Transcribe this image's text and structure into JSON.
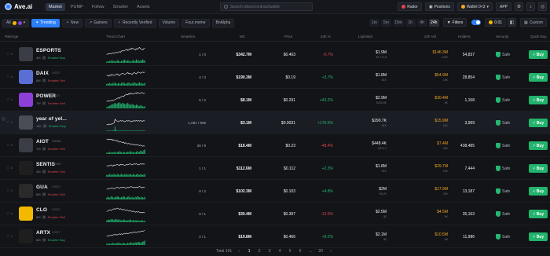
{
  "app": {
    "name": "Ave.ai"
  },
  "nav": [
    "Market",
    "PUMP",
    "Follow",
    "Smarter",
    "Assets"
  ],
  "search": {
    "placeholder": "Search token/contract/wallet"
  },
  "topbar": {
    "rador": "Rador",
    "positions": "Positions",
    "wallet": "Wallet 0×3",
    "app": "APP"
  },
  "filters": {
    "chain": "All",
    "chips": [
      "Trending",
      "New",
      "Gainers",
      "Recently Verified",
      "Volume",
      "Four.meme",
      "BnAlpha"
    ],
    "times": [
      "1m",
      "5m",
      "15m",
      "1h",
      "4h",
      "24h"
    ],
    "filters_label": "Filters",
    "sol": "0.01",
    "custom": "Custom"
  },
  "header": {
    "pair_age": "Pair/Age",
    "trend": "Trend Chart",
    "smarters": "Smarters",
    "mc": "MC",
    "price": "Price",
    "chg": "24h %",
    "liq": "Liq/Initial",
    "vol": "24h Vol",
    "holders": "Holders",
    "security": "Security",
    "quick_buy": "Quick Buy"
  },
  "rows": [
    {
      "name": "ESPORTS",
      "tk": "/WBNB",
      "age": "4M",
      "tag": "Smarter Buy",
      "tagtype": "b",
      "smart": "1 / 0",
      "mc": "$342.7M",
      "price": "$0.403",
      "chg": "-0.7%",
      "dir": "dn",
      "liq": "$1.9M",
      "liq2": "$1,771.8",
      "vol": "$146.3M",
      "vol2": "140K",
      "hold": "54,837",
      "color": "#3a3d45",
      "spark": [
        6,
        7,
        7,
        8,
        7,
        8,
        9,
        8,
        9,
        10,
        9,
        10,
        11,
        10,
        12,
        13,
        12,
        13,
        14,
        15,
        13,
        14,
        16,
        15,
        17,
        16,
        15,
        14,
        16,
        15,
        17,
        18,
        16,
        15,
        14,
        16,
        17
      ],
      "bars": [
        2,
        3,
        2,
        4,
        3,
        5,
        3,
        4,
        2,
        3,
        5,
        4,
        3,
        2,
        4,
        3,
        5,
        6,
        4,
        3,
        5,
        4,
        3,
        2,
        4,
        5,
        3,
        4,
        6,
        5,
        4,
        3,
        5,
        4,
        6,
        5,
        4
      ]
    },
    {
      "name": "DAIX",
      "tk": "/USDT",
      "age": "8M",
      "tag": "Smarter Sell",
      "tagtype": "s",
      "smart": "4 / 3",
      "mc": "$190.3M",
      "price": "$0.19",
      "chg": "+3.7%",
      "dir": "up",
      "liq": "$1.8M",
      "liq2": "$1K",
      "vol": "$54.9M",
      "vol2": "16K",
      "hold": "28,854",
      "color": "#5a6fd6",
      "spark": [
        10,
        9,
        8,
        10,
        9,
        11,
        10,
        9,
        10,
        11,
        12,
        10,
        9,
        11,
        12,
        13,
        12,
        11,
        12,
        13,
        14,
        12,
        13,
        12,
        11,
        13,
        14,
        13,
        12,
        14,
        15,
        14,
        13,
        14,
        15,
        14,
        15
      ],
      "bars": [
        3,
        4,
        3,
        5,
        4,
        3,
        5,
        4,
        6,
        4,
        3,
        5,
        4,
        3,
        5,
        6,
        4,
        5,
        3,
        4,
        5,
        6,
        4,
        3,
        5,
        4,
        6,
        5,
        4,
        3,
        5,
        6,
        4,
        5,
        3,
        4,
        5
      ]
    },
    {
      "name": "POWER",
      "tk": "/USDT",
      "age": "7M",
      "tag": "Smarter Sell",
      "tagtype": "s",
      "smart": "5 / 2",
      "mc": "$8.1M",
      "price": "$0.291",
      "chg": "+43.2%",
      "dir": "up",
      "liq": "$2.9M",
      "liq2": "$400.8K",
      "vol": "$30.4M",
      "vol2": "6K",
      "hold": "1,158",
      "color": "#8e3fd8",
      "spark": [
        4,
        4,
        5,
        4,
        5,
        6,
        5,
        6,
        7,
        8,
        9,
        10,
        9,
        11,
        12,
        13,
        12,
        14,
        15,
        16,
        15,
        17,
        16,
        18,
        17,
        16,
        17,
        18,
        17,
        19,
        18,
        17,
        18,
        19,
        18,
        17,
        18
      ],
      "bars": [
        2,
        3,
        4,
        5,
        6,
        8,
        7,
        9,
        10,
        8,
        9,
        10,
        11,
        9,
        8,
        10,
        9,
        8,
        7,
        9,
        10,
        8,
        7,
        6,
        8,
        7,
        6,
        5,
        7,
        6,
        5,
        4,
        6,
        5,
        4,
        3,
        4
      ]
    },
    {
      "name": "year of yel...",
      "tk": "",
      "age": "16h",
      "tag": "Smarter Buy",
      "tagtype": "b",
      "smart": "1,091 / 905",
      "mc": "$3.1M",
      "price": "$0.0031",
      "chg": "+176.5%",
      "dir": "up",
      "liq": "$290.7K",
      "liq2": "$1K",
      "vol": "$15.9M",
      "vol2": "61K",
      "hold": "3,999",
      "color": "#4a4d55",
      "spark": [
        3,
        3,
        4,
        3,
        4,
        4,
        5,
        6,
        12,
        10,
        9,
        8,
        9,
        10,
        9,
        10,
        9,
        8,
        9,
        10,
        9,
        10,
        9,
        8,
        9,
        9,
        10,
        9,
        10,
        9,
        10,
        9,
        10,
        9,
        9,
        10,
        9
      ],
      "bars": [
        1,
        1,
        1,
        1,
        1,
        1,
        1,
        2,
        8,
        2,
        1,
        1,
        1,
        1,
        1,
        1,
        1,
        1,
        1,
        1,
        1,
        1,
        1,
        1,
        1,
        1,
        1,
        1,
        1,
        1,
        1,
        1,
        1,
        1,
        1,
        1,
        1
      ]
    },
    {
      "name": "AIOT",
      "tk": "/WBNB",
      "age": "7M",
      "tag": "Smarter Sell",
      "tagtype": "s",
      "smart": "26 / 9",
      "mc": "$18.4M",
      "price": "$0.23",
      "chg": "-48.4%",
      "dir": "dn",
      "liq": "$448.4K",
      "liq2": "$211.2",
      "vol": "$7.4M",
      "vol2": "26K",
      "hold": "438,485",
      "color": "#3a3d45",
      "spark": [
        17,
        17,
        16,
        17,
        16,
        17,
        15,
        16,
        15,
        14,
        15,
        13,
        12,
        13,
        12,
        11,
        12,
        10,
        11,
        10,
        9,
        10,
        9,
        8,
        9,
        8,
        7,
        8,
        7,
        8,
        7,
        6,
        7,
        6,
        5,
        6,
        5
      ],
      "bars": [
        2,
        3,
        2,
        4,
        3,
        2,
        3,
        4,
        3,
        2,
        4,
        3,
        5,
        4,
        3,
        2,
        4,
        3,
        2,
        3,
        4,
        3,
        5,
        4,
        3,
        4,
        2,
        3,
        4,
        5,
        3,
        4,
        6,
        5,
        4,
        7,
        8
      ]
    },
    {
      "name": "SENTIS",
      "tk": "/WBNB",
      "age": "4M",
      "tag": "Smarter Sell",
      "tagtype": "s",
      "smart": "1 / 1",
      "mc": "$112.6M",
      "price": "$0.112",
      "chg": "+2.3%",
      "dir": "up",
      "liq": "$1.8M",
      "liq2": "$1K",
      "vol": "$29.7M",
      "vol2": "16K",
      "hold": "7,444",
      "color": "#1e1e1e",
      "spark": [
        10,
        11,
        10,
        11,
        12,
        11,
        10,
        12,
        11,
        12,
        13,
        12,
        11,
        13,
        12,
        13,
        12,
        11,
        12,
        13,
        12,
        13,
        14,
        13,
        12,
        13,
        14,
        13,
        14,
        13,
        12,
        13,
        14,
        13,
        14,
        13,
        14
      ],
      "bars": [
        3,
        4,
        3,
        5,
        4,
        3,
        4,
        5,
        4,
        3,
        5,
        4,
        3,
        4,
        5,
        4,
        3,
        5,
        4,
        5,
        3,
        4,
        5,
        4,
        3,
        5,
        4,
        3,
        4,
        5,
        4,
        3,
        5,
        4,
        3,
        4,
        5
      ]
    },
    {
      "name": "GUA",
      "tk": "/USDT",
      "age": "8M",
      "tag": "Smarter Sell",
      "tagtype": "s",
      "smart": "0 / 2",
      "mc": "$102.3M",
      "price": "$0.103",
      "chg": "+4.8%",
      "dir": "up",
      "liq": "$2M",
      "liq2": "$6.2K",
      "vol": "$17.9M",
      "vol2": "32K",
      "hold": "13,187",
      "color": "#2a2a2a",
      "spark": [
        9,
        10,
        11,
        10,
        11,
        12,
        11,
        10,
        11,
        12,
        13,
        12,
        11,
        12,
        13,
        12,
        13,
        12,
        11,
        12,
        13,
        12,
        13,
        14,
        13,
        12,
        13,
        12,
        13,
        12,
        13,
        14,
        13,
        12,
        13,
        12,
        13
      ],
      "bars": [
        3,
        5,
        4,
        3,
        5,
        6,
        4,
        3,
        5,
        4,
        6,
        5,
        4,
        3,
        5,
        4,
        6,
        5,
        3,
        4,
        5,
        6,
        4,
        3,
        5,
        4,
        3,
        5,
        4,
        6,
        5,
        4,
        3,
        5,
        4,
        3,
        5
      ]
    },
    {
      "name": "CLO",
      "tk": "/USDT",
      "age": "8M",
      "tag": "Smarter Sell",
      "tagtype": "s",
      "smart": "0 / 1",
      "mc": "$30.4M",
      "price": "$0.397",
      "chg": "-12.6%",
      "dir": "dn",
      "liq": "$2.5M",
      "liq2": "$0",
      "vol": "$4.5M",
      "vol2": "9K",
      "hold": "35,163",
      "color": "#f5b800",
      "spark": [
        10,
        11,
        12,
        13,
        12,
        13,
        14,
        15,
        14,
        15,
        16,
        15,
        14,
        15,
        14,
        13,
        14,
        13,
        12,
        13,
        12,
        11,
        12,
        11,
        10,
        11,
        10,
        9,
        10,
        9,
        10,
        9,
        8,
        9,
        8,
        9,
        8
      ],
      "bars": [
        3,
        4,
        5,
        4,
        5,
        6,
        5,
        4,
        5,
        6,
        5,
        4,
        5,
        4,
        3,
        4,
        5,
        4,
        3,
        4,
        3,
        4,
        5,
        4,
        3,
        4,
        3,
        4,
        3,
        4,
        3,
        2,
        3,
        4,
        3,
        2,
        3
      ]
    },
    {
      "name": "ARTX",
      "tk": "/USDT",
      "age": "8M",
      "tag": "Smarter Buy",
      "tagtype": "b",
      "smart": "2 / 1",
      "mc": "$19.8M",
      "price": "$0.466",
      "chg": "+9.2%",
      "dir": "up",
      "liq": "$2.1M",
      "liq2": "$0",
      "vol": "$10.5M",
      "vol2": "1M",
      "hold": "11,986",
      "color": "#1e1e1e",
      "spark": [
        7,
        8,
        7,
        8,
        9,
        8,
        9,
        10,
        9,
        10,
        9,
        10,
        11,
        10,
        11,
        10,
        11,
        12,
        11,
        12,
        11,
        12,
        13,
        12,
        13,
        14,
        13,
        14,
        13,
        14,
        15,
        14,
        15,
        16,
        15,
        16,
        17
      ],
      "bars": [
        2,
        3,
        2,
        3,
        2,
        3,
        4,
        3,
        2,
        3,
        4,
        3,
        4,
        3,
        2,
        3,
        4,
        3,
        2,
        3,
        4,
        3,
        4,
        5,
        4,
        3,
        4,
        5,
        4,
        5,
        6,
        5,
        4,
        5,
        6,
        7,
        8
      ]
    }
  ],
  "footer": {
    "total": "Total 191",
    "pages": [
      "1",
      "2",
      "3",
      "4",
      "5",
      "6",
      "...",
      "20"
    ]
  }
}
